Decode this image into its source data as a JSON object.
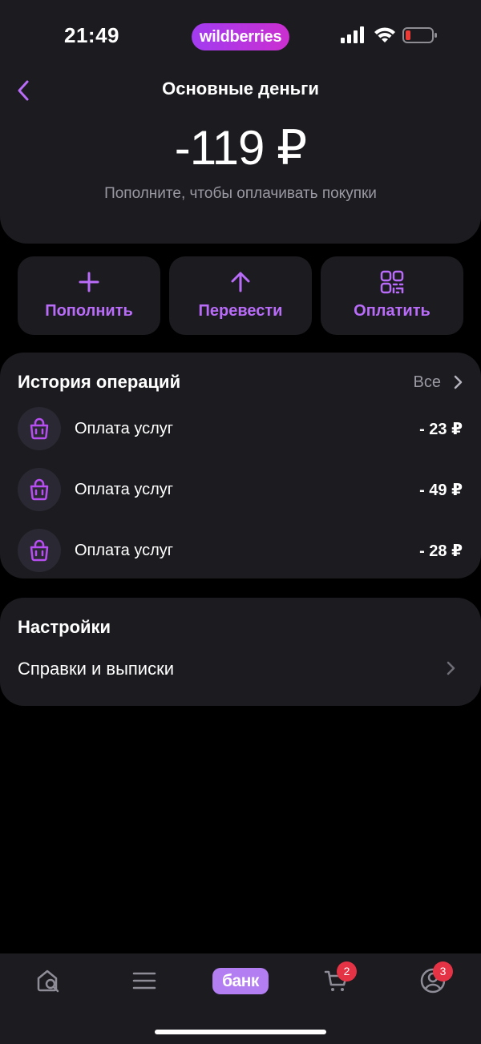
{
  "status_bar": {
    "time": "21:49",
    "brand": "wildberries",
    "icons": [
      "signal-icon",
      "wifi-icon",
      "battery-low-icon"
    ]
  },
  "header": {
    "title": "Основные деньги",
    "balance": "-119 ₽",
    "hint": "Пополните, чтобы оплачивать покупки"
  },
  "actions": [
    {
      "label": "Пополнить",
      "icon": "plus-icon"
    },
    {
      "label": "Перевести",
      "icon": "arrow-up-icon"
    },
    {
      "label": "Оплатить",
      "icon": "qr-code-icon"
    }
  ],
  "history": {
    "title": "История операций",
    "all_label": "Все",
    "operations": [
      {
        "name": "Оплата услуг",
        "amount": "- 23 ₽",
        "icon": "shopping-bag-icon"
      },
      {
        "name": "Оплата услуг",
        "amount": "- 49 ₽",
        "icon": "shopping-bag-icon"
      },
      {
        "name": "Оплата услуг",
        "amount": "- 28 ₽",
        "icon": "shopping-bag-icon"
      }
    ]
  },
  "settings": {
    "title": "Настройки",
    "items": [
      {
        "label": "Справки и выписки"
      }
    ]
  },
  "tab_bar": {
    "tabs": [
      {
        "name": "home",
        "icon": "home-search-icon"
      },
      {
        "name": "menu",
        "icon": "menu-icon"
      },
      {
        "name": "bank",
        "label": "банк"
      },
      {
        "name": "cart",
        "icon": "cart-icon",
        "badge": "2"
      },
      {
        "name": "profile",
        "icon": "profile-icon",
        "badge": "3"
      }
    ]
  },
  "colors": {
    "accent": "#b86cf7",
    "card": "#1c1b20",
    "background": "#000000",
    "badge": "#e53346"
  }
}
